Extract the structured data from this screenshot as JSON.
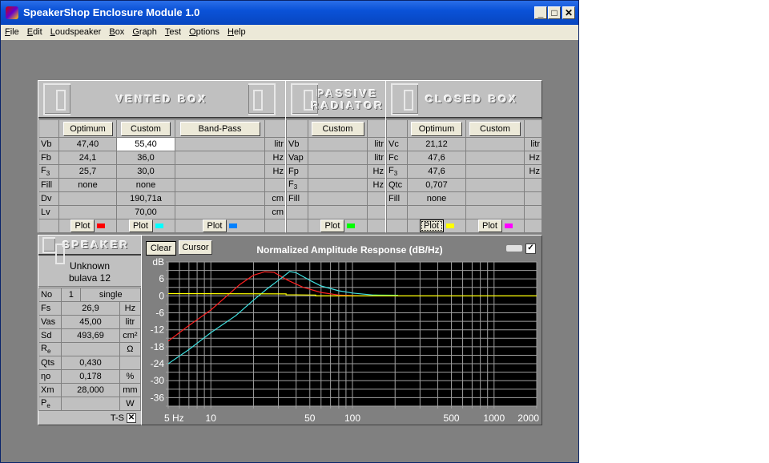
{
  "window": {
    "title": "SpeakerShop Enclosure Module 1.0",
    "minimize": "_",
    "maximize": "□",
    "close": "✕"
  },
  "menu": [
    "File",
    "Edit",
    "Loudspeaker",
    "Box",
    "Graph",
    "Test",
    "Options",
    "Help"
  ],
  "vented": {
    "title": "VENTED BOX",
    "buttons": [
      "Optimum",
      "Custom",
      "Band-Pass"
    ],
    "rows": [
      {
        "label": "Vb",
        "optimum": "47,40",
        "custom": "55,40",
        "bandpass": "",
        "unit": "litr"
      },
      {
        "label": "Fb",
        "optimum": "24,1",
        "custom": "36,0",
        "bandpass": "",
        "unit": "Hz"
      },
      {
        "label": "F3",
        "optimum": "25,7",
        "custom": "30,0",
        "bandpass": "",
        "unit": "Hz"
      },
      {
        "label": "Fill",
        "optimum": "none",
        "custom": "none",
        "bandpass": "",
        "unit": ""
      },
      {
        "label": "Dv",
        "optimum": "",
        "custom": "190,71a",
        "bandpass": "",
        "unit": "cm"
      },
      {
        "label": "Lv",
        "optimum": "",
        "custom": "70,00",
        "bandpass": "",
        "unit": "cm"
      }
    ],
    "plot_label": "Plot",
    "plot_colors": [
      "#ff0000",
      "#00ffff",
      "#0080ff"
    ]
  },
  "passive": {
    "title_line1": "PASSIVE",
    "title_line2": "RADIATOR",
    "button": "Custom",
    "rows": [
      {
        "label": "Vb",
        "value": "",
        "unit": "litr"
      },
      {
        "label": "Vap",
        "value": "",
        "unit": "litr"
      },
      {
        "label": "Fp",
        "value": "",
        "unit": "Hz"
      },
      {
        "label": "F3",
        "value": "",
        "unit": "Hz"
      },
      {
        "label": "Fill",
        "value": "",
        "unit": ""
      },
      {
        "label": "",
        "value": "",
        "unit": ""
      }
    ],
    "plot_label": "Plot",
    "plot_color": "#00ff00"
  },
  "closed": {
    "title": "CLOSED BOX",
    "buttons": [
      "Optimum",
      "Custom"
    ],
    "rows": [
      {
        "label": "Vc",
        "optimum": "21,12",
        "custom": "",
        "unit": "litr"
      },
      {
        "label": "Fc",
        "optimum": "47,6",
        "custom": "",
        "unit": "Hz"
      },
      {
        "label": "F3",
        "optimum": "47,6",
        "custom": "",
        "unit": "Hz"
      },
      {
        "label": "Qtc",
        "optimum": "0,707",
        "custom": "",
        "unit": ""
      },
      {
        "label": "Fill",
        "optimum": "none",
        "custom": "",
        "unit": ""
      },
      {
        "label": "",
        "optimum": "",
        "custom": "",
        "unit": ""
      }
    ],
    "plot_label": "Plot",
    "plot_colors": [
      "#ffff00",
      "#ff00ff"
    ]
  },
  "speaker": {
    "title": "SPEAKER",
    "name1": "Unknown",
    "name2": "bulava 12",
    "no_label": "No",
    "no_value": "1",
    "no_mode": "single",
    "rows": [
      {
        "label": "Fs",
        "value": "26,9",
        "unit": "Hz"
      },
      {
        "label": "Vas",
        "value": "45,00",
        "unit": "litr"
      },
      {
        "label": "Sd",
        "value": "493,69",
        "unit": "cm²"
      },
      {
        "label": "Re",
        "value": "",
        "unit": "Ω"
      },
      {
        "label": "Qts",
        "value": "0,430",
        "unit": ""
      },
      {
        "label": "ηo",
        "value": "0,178",
        "unit": "%"
      },
      {
        "label": "Xm",
        "value": "28,000",
        "unit": "mm"
      },
      {
        "label": "Pe",
        "value": "",
        "unit": "W"
      }
    ],
    "ts_label": "T-S",
    "ts_checked": "✕"
  },
  "graph": {
    "clear": "Clear",
    "cursor": "Cursor",
    "check": "✓"
  },
  "chart_data": {
    "type": "line",
    "title": "Normalized Amplitude Response (dB/Hz)",
    "xscale": "log",
    "xlim": [
      5,
      2000
    ],
    "ylim": [
      -39,
      12
    ],
    "yticks": [
      "dB",
      "6",
      "0",
      "-6",
      "-12",
      "-18",
      "-24",
      "-30",
      "-36"
    ],
    "xticks": [
      "5 Hz",
      "10",
      "50",
      "100",
      "500",
      "1000",
      "2000"
    ],
    "grid": true,
    "background": "#000000",
    "series": [
      {
        "color": "#ff2020",
        "points": [
          [
            5,
            -16
          ],
          [
            7,
            -10.5
          ],
          [
            10,
            -5
          ],
          [
            13,
            0
          ],
          [
            16,
            4
          ],
          [
            20,
            7.3
          ],
          [
            24,
            8.5
          ],
          [
            28,
            8.3
          ],
          [
            35,
            5.5
          ],
          [
            45,
            3
          ],
          [
            60,
            1.2
          ],
          [
            80,
            0.3
          ],
          [
            110,
            0
          ]
        ]
      },
      {
        "color": "#40e0e0",
        "points": [
          [
            5,
            -24
          ],
          [
            7,
            -19
          ],
          [
            10,
            -13
          ],
          [
            15,
            -7
          ],
          [
            20,
            -1.5
          ],
          [
            25,
            2.5
          ],
          [
            30,
            5.5
          ],
          [
            36,
            8.6
          ],
          [
            40,
            8.2
          ],
          [
            50,
            5.5
          ],
          [
            60,
            3.5
          ],
          [
            80,
            1.8
          ],
          [
            100,
            1
          ],
          [
            140,
            0.3
          ],
          [
            200,
            0
          ]
        ]
      },
      {
        "color": "#40ff80",
        "points": [
          [
            140,
            0.3
          ],
          [
            210,
            0.2
          ]
        ]
      },
      {
        "color": "#ffff00",
        "points": [
          [
            5,
            0.8
          ],
          [
            34,
            0.7
          ],
          [
            34,
            0.4
          ],
          [
            55,
            0.3
          ],
          [
            55,
            0
          ],
          [
            2000,
            0
          ]
        ]
      }
    ]
  }
}
